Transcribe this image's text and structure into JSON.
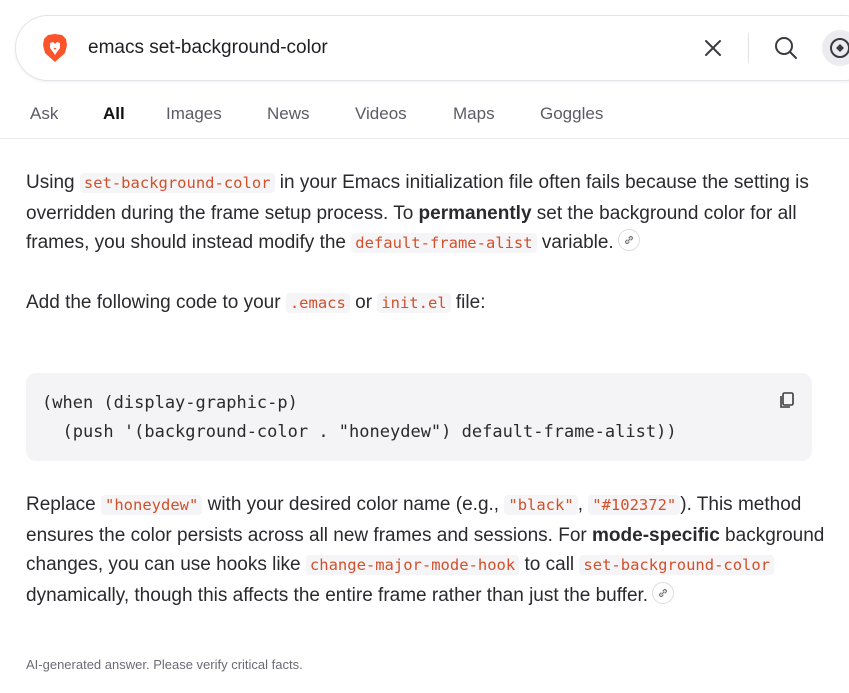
{
  "search": {
    "query": "emacs set-background-color"
  },
  "tabs": [
    {
      "label": "Ask",
      "active": false
    },
    {
      "label": "All",
      "active": true
    },
    {
      "label": "Images",
      "active": false
    },
    {
      "label": "News",
      "active": false
    },
    {
      "label": "Videos",
      "active": false
    },
    {
      "label": "Maps",
      "active": false
    },
    {
      "label": "Goggles",
      "active": false
    }
  ],
  "answer": {
    "p1": {
      "t1": "Using ",
      "c1": "set-background-color",
      "t2": " in your Emacs initialization file often fails because the setting is overridden during the frame setup process. To ",
      "b1": "permanently",
      "t3": " set the background color for all frames, you should instead modify the ",
      "c2": "default-frame-alist",
      "t4": " variable."
    },
    "p2": {
      "t1": "Add the following code to your ",
      "c1": ".emacs",
      "t2": " or ",
      "c2": "init.el",
      "t3": " file:"
    },
    "code_block": {
      "line1": "(when (display-graphic-p)",
      "line2": "  (push '(background-color . \"honeydew\") default-frame-alist))"
    },
    "p3": {
      "t1": "Replace ",
      "c1": "\"honeydew\"",
      "t2": " with your desired color name (e.g., ",
      "c2": "\"black\"",
      "t3": ", ",
      "c3": "\"#102372\"",
      "t4": "). This method ensures the color persists across all new frames and sessions. For ",
      "b1": "mode-specific",
      "t5": " background changes, you can use hooks like ",
      "c4": "change-major-mode-hook",
      "t6": " to call ",
      "c5": "set-background-color",
      "t7": " dynamically, though this affects the entire frame rather than just the buffer."
    },
    "disclaimer": "AI-generated answer. Please verify critical facts."
  },
  "colors": {
    "brand": "#fb542b",
    "code_text": "#d2502a",
    "code_bg": "#f5f5f7"
  },
  "icons": [
    "brave-lion-icon",
    "close-icon",
    "search-icon",
    "ai-chat-icon",
    "link-icon",
    "copy-icon"
  ]
}
